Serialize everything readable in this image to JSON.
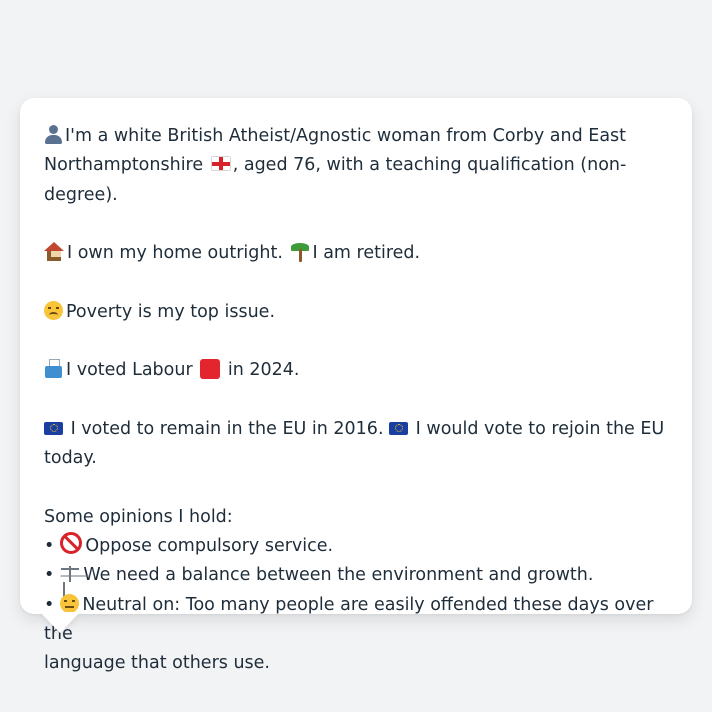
{
  "profile": {
    "identity": {
      "text_before_flag": "I'm a white British Atheist/Agnostic woman from Corby and East",
      "text_line2_before_flag": "Northamptonshire",
      "text_after_flag": ", aged 76, with a teaching qualification (non-degree)."
    },
    "housing": {
      "home_text": "I own my home outright.",
      "retired_text": "I am retired."
    },
    "issue": {
      "text": "Poverty is my top issue."
    },
    "vote": {
      "text_before": "I voted Labour",
      "text_after": "in 2024.",
      "party_color": "#e3262e"
    },
    "eu": {
      "remain_text": "I voted to remain in the EU in 2016.",
      "rejoin_text": "I would vote to rejoin the EU today."
    },
    "opinions": {
      "heading": "Some opinions I hold:",
      "bullet": "•",
      "items": [
        {
          "icon": "prohibited-icon",
          "text": "Oppose compulsory service."
        },
        {
          "icon": "balance-scale-icon",
          "text": "We need a balance between the environment and growth."
        },
        {
          "icon": "neutral-face-icon",
          "text_line1": "Neutral on: Too many people are easily offended these days over the",
          "text_line2": "language that others use."
        }
      ]
    }
  }
}
